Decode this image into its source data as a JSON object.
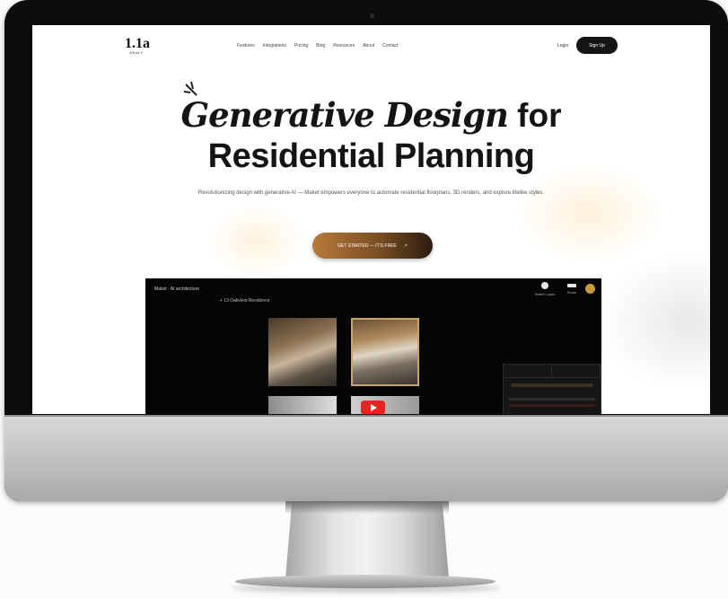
{
  "nav": {
    "logo_mark": "1.1a",
    "logo_word": "ANALY",
    "links": [
      "Features",
      "Integrations",
      "Pricing",
      "Blog",
      "Resources",
      "About",
      "Contact"
    ],
    "login": "Login",
    "signup": "Sign Up"
  },
  "hero": {
    "title_italic": "Generative Design",
    "title_plain": " for",
    "title_line2": "Residential Planning",
    "subtitle": "Revolutionizing design with generative AI — Maket empowers everyone to automate residential floorplans, 3D renders, and explore lifelike styles.",
    "cta_label": "GET STARTED — IT'S FREE",
    "cta_arrow": "↗"
  },
  "app": {
    "breadcrumb": "Maket · AI architecture",
    "project": "+ 13 Oakview Residence",
    "tools": [
      {
        "label": "Switch Layer",
        "icon": "layers-icon"
      },
      {
        "label": "Share",
        "icon": "share-icon"
      }
    ]
  },
  "colors": {
    "accent": "#b87a3a",
    "dark": "#151515",
    "youtube": "#e5261f"
  }
}
